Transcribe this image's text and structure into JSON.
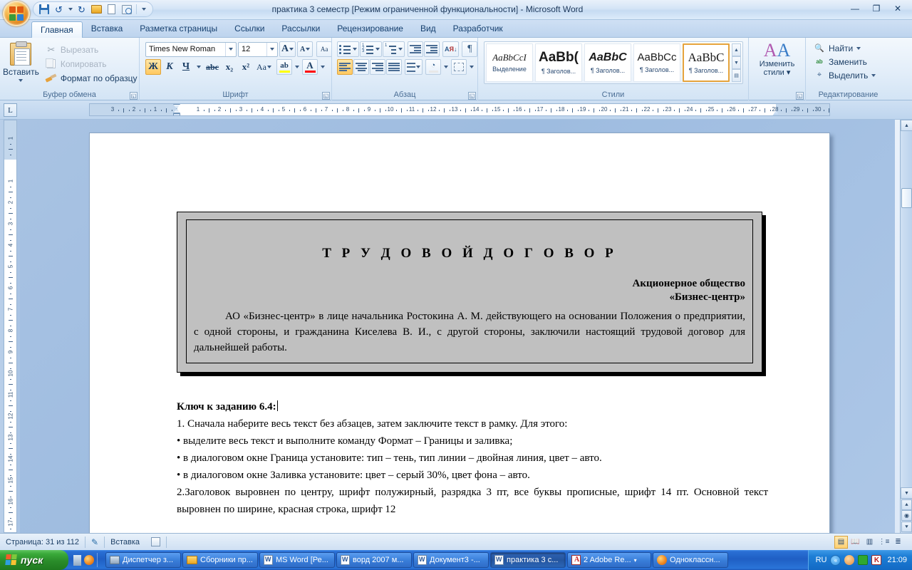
{
  "window": {
    "title": "практика 3 семестр [Режим ограниченной функциональности] - Microsoft Word",
    "minimize": "—",
    "restore": "❐",
    "close": "✕"
  },
  "quick_access": {
    "save": "save-icon",
    "undo": "↺",
    "undo_arrow": "▾",
    "redo": "↻",
    "open": "open-icon",
    "new": "new-icon",
    "print_preview": "print-preview-icon",
    "customize": "▾"
  },
  "tabs": [
    {
      "label": "Главная",
      "active": true
    },
    {
      "label": "Вставка",
      "active": false
    },
    {
      "label": "Разметка страницы",
      "active": false
    },
    {
      "label": "Ссылки",
      "active": false
    },
    {
      "label": "Рассылки",
      "active": false
    },
    {
      "label": "Рецензирование",
      "active": false
    },
    {
      "label": "Вид",
      "active": false
    },
    {
      "label": "Разработчик",
      "active": false
    }
  ],
  "ribbon": {
    "clipboard": {
      "label": "Буфер обмена",
      "paste": "Вставить",
      "paste_arrow": "▾",
      "cut": "Вырезать",
      "copy": "Копировать",
      "format_painter": "Формат по образцу"
    },
    "font": {
      "label": "Шрифт",
      "font_name": "Times New Roman",
      "font_size": "12",
      "grow": "A",
      "shrink": "A",
      "clear_format": "Aa",
      "bold": "Ж",
      "italic": "К",
      "underline": "Ч",
      "strikethrough": "abc",
      "subscript": "x₂",
      "superscript": "x²",
      "change_case": "Aa",
      "highlight": "ab",
      "font_color": "A",
      "highlight_color": "#ffff00",
      "font_color_value": "#ff0000",
      "arrow": "▾"
    },
    "paragraph": {
      "label": "Абзац",
      "bullets": "bullets-icon",
      "numbering": "numbering-icon",
      "multilevel": "multilevel-list-icon",
      "decrease_indent": "decrease-indent-icon",
      "increase_indent": "increase-indent-icon",
      "sort": "sort-icon",
      "show_marks": "¶",
      "align_left": "align-left-icon",
      "align_center": "align-center-icon",
      "align_right": "align-right-icon",
      "justify": "justify-icon",
      "line_spacing": "line-spacing-icon",
      "shading": "shading-icon",
      "borders": "borders-icon",
      "arrow": "▾"
    },
    "styles": {
      "label": "Стили",
      "items": [
        {
          "preview": "AaBbCcI",
          "name": "Выделение",
          "selected": false,
          "style": "italic-serif"
        },
        {
          "preview": "AaBb(",
          "name": "¶ Заголов...",
          "selected": false,
          "style": "bold-big"
        },
        {
          "preview": "AaBbC",
          "name": "¶ Заголов...",
          "selected": false,
          "style": "bold-italic"
        },
        {
          "preview": "AaBbCc",
          "name": "¶ Заголов...",
          "selected": false,
          "style": "normal-sans"
        },
        {
          "preview": "AaBbC",
          "name": "¶ Заголов...",
          "selected": true,
          "style": "serif-bold"
        }
      ],
      "scroll_up": "▲",
      "scroll_down": "▼",
      "more": "▤"
    },
    "change_styles": {
      "line1": "Изменить",
      "line2": "стили",
      "arrow": "▾",
      "icon": "AA"
    },
    "editing": {
      "label": "Редактирование",
      "find": "Найти",
      "find_arrow": "▾",
      "replace": "Заменить",
      "select": "Выделить",
      "select_arrow": "▾"
    }
  },
  "ruler": {
    "tab_selector": "L",
    "h_numbers": [
      "2",
      "1",
      "1",
      "2",
      "3",
      "4",
      "5",
      "6",
      "7",
      "8",
      "9",
      "10",
      "11",
      "12",
      "13",
      "14",
      "15",
      "16",
      "18"
    ],
    "v_numbers": [
      "1",
      "1",
      "2",
      "3",
      "4",
      "5",
      "6",
      "7",
      "8",
      "9"
    ]
  },
  "document": {
    "title": "Т Р У Д О В О Й   Д О Г О В О Р",
    "company_line1": "Акционерное общество",
    "company_line2": "«Бизнес-центр»",
    "body": "АО «Бизнес-центр» в лице начальника Ростокина А. М. действующего на основании Положения о предприятии, с одной стороны, и гражданина Киселева В. И., с другой стороны, заключили настоящий трудовой договор для дальнейшей работы.",
    "key_heading": "Ключ к заданию 6.4:",
    "lines": [
      "1. Сначала наберите весь текст без абзацев, затем заключите текст в рамку. Для этого:",
      "• выделите весь текст и выполните команду Формат – Границы и заливка;",
      "• в диалоговом окне Граница установите: тип – тень, тип линии – двойная линия, цвет – авто.",
      "• в диалоговом окне Заливка установите: цвет – серый 30%, цвет фона – авто.",
      "2.Заголовок выровнен по центру, шрифт полужирный, разрядка 3 пт, все буквы прописные, шрифт 14 пт. Основной текст выровнен по ширине, красная строка, шрифт 12"
    ]
  },
  "status_bar": {
    "page": "Страница: 31 из 112",
    "proofing_icon": "proofing-error-icon",
    "insert_mode": "Вставка",
    "macro_icon": "macro-record-icon",
    "views": [
      "print-layout-icon",
      "full-screen-reading-icon",
      "web-layout-icon",
      "outline-icon",
      "draft-icon"
    ]
  },
  "taskbar": {
    "start": "пуск",
    "quicklaunch": [
      "calculator-icon",
      "firefox-icon"
    ],
    "buttons": [
      {
        "label": "Диспетчер з...",
        "icon": "pc",
        "active": false
      },
      {
        "label": "Сборники пр...",
        "icon": "folder",
        "active": false
      },
      {
        "label": "MS Word [Ре...",
        "icon": "word",
        "active": false
      },
      {
        "label": "ворд  2007 м...",
        "icon": "word",
        "active": false
      },
      {
        "label": "Документ3 -...",
        "icon": "word",
        "active": false
      },
      {
        "label": "практика 3 с...",
        "icon": "word",
        "active": true
      },
      {
        "label": "2 Adobe Re...",
        "icon": "acrobat",
        "active": false,
        "group_arrow": "▾"
      },
      {
        "label": "Однокласcн...",
        "icon": "firefox",
        "active": false
      }
    ],
    "tray": {
      "language": "RU",
      "expand": "«",
      "icons": [
        "avatar-icon",
        "green-grid-icon",
        "kaspersky-icon"
      ],
      "clock": "21:09"
    }
  }
}
